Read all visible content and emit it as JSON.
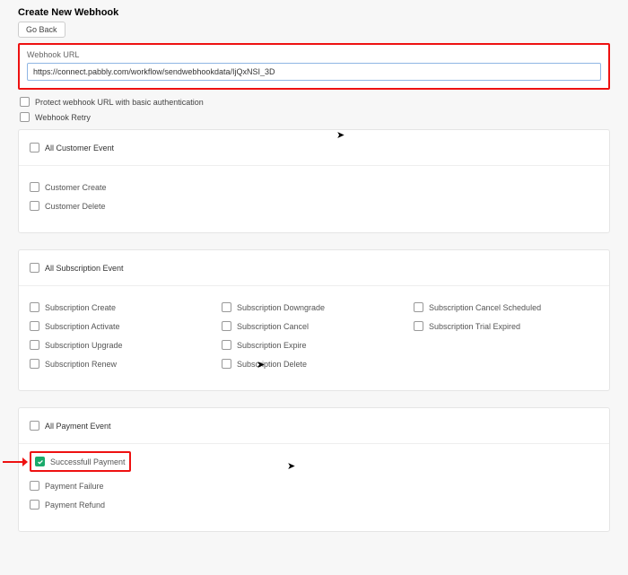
{
  "header": {
    "title": "Create New Webhook",
    "go_back": "Go Back"
  },
  "url": {
    "label": "Webhook URL",
    "value": "https://connect.pabbly.com/workflow/sendwebhookdata/IjQxNSI_3D"
  },
  "options": {
    "protect": "Protect webhook URL with basic authentication",
    "retry": "Webhook Retry"
  },
  "customer": {
    "all": "All Customer Event",
    "create": "Customer Create",
    "delete": "Customer Delete"
  },
  "subscription": {
    "all": "All Subscription Event",
    "colA": {
      "create": "Subscription Create",
      "activate": "Subscription Activate",
      "upgrade": "Subscription Upgrade",
      "renew": "Subscription Renew"
    },
    "colB": {
      "downgrade": "Subscription Downgrade",
      "cancel": "Subscription Cancel",
      "expire": "Subscription Expire",
      "delete": "Subscription Delete"
    },
    "colC": {
      "cancel_scheduled": "Subscription Cancel Scheduled",
      "trial_expired": "Subscription Trial Expired"
    }
  },
  "payment": {
    "all": "All Payment Event",
    "success": "Successfull Payment",
    "failure": "Payment Failure",
    "refund": "Payment Refund"
  }
}
